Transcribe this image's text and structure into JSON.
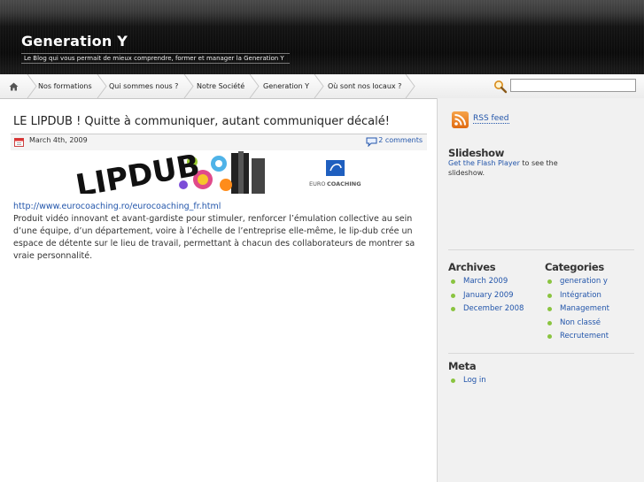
{
  "header": {
    "title": "Generation Y",
    "tagline": "Le Blog qui vous permait de mieux comprendre, former et manager la Generation Y"
  },
  "nav": {
    "items": [
      "Nos formations",
      "Qui sommes nous ?",
      "Notre Société",
      "Generation Y",
      "Où sont nos locaux ?"
    ],
    "search_value": ""
  },
  "post": {
    "title": "LE LIPDUB ! Quitte à communiquer, autant communiquer décalé!",
    "date": "March 4th, 2009",
    "comments": "2 comments",
    "image_text": "LIPDUB",
    "logo_text_1": "EURO",
    "logo_text_2": "COACHING",
    "link": "http://www.eurocoaching.ro/eurocoaching_fr.html",
    "body": "Produit vidéo innovant et avant-gardiste pour stimuler, renforcer l’émulation collective au sein d’une équipe, d’un département, voire à l’échelle de l’entreprise elle-même, le lip-dub crée un espace de détente sur le lieu de travail, permettant à chacun des collaborateurs de montrer sa vraie personnalité."
  },
  "sidebar": {
    "rss": "RSS feed",
    "slideshow_title": "Slideshow",
    "slideshow_link": "Get the Flash Player",
    "slideshow_text": " to see the slideshow.",
    "archives_title": "Archives",
    "archives": [
      "March 2009",
      "January 2009",
      "December 2008"
    ],
    "categories_title": "Categories",
    "categories": [
      "generation y",
      "Intégration",
      "Management",
      "Non classé",
      "Recrutement"
    ],
    "meta_title": "Meta",
    "meta": [
      "Log in"
    ]
  },
  "colors": {
    "link": "#2255aa",
    "bullet": "#8ac440",
    "rss": "#f08a24"
  }
}
